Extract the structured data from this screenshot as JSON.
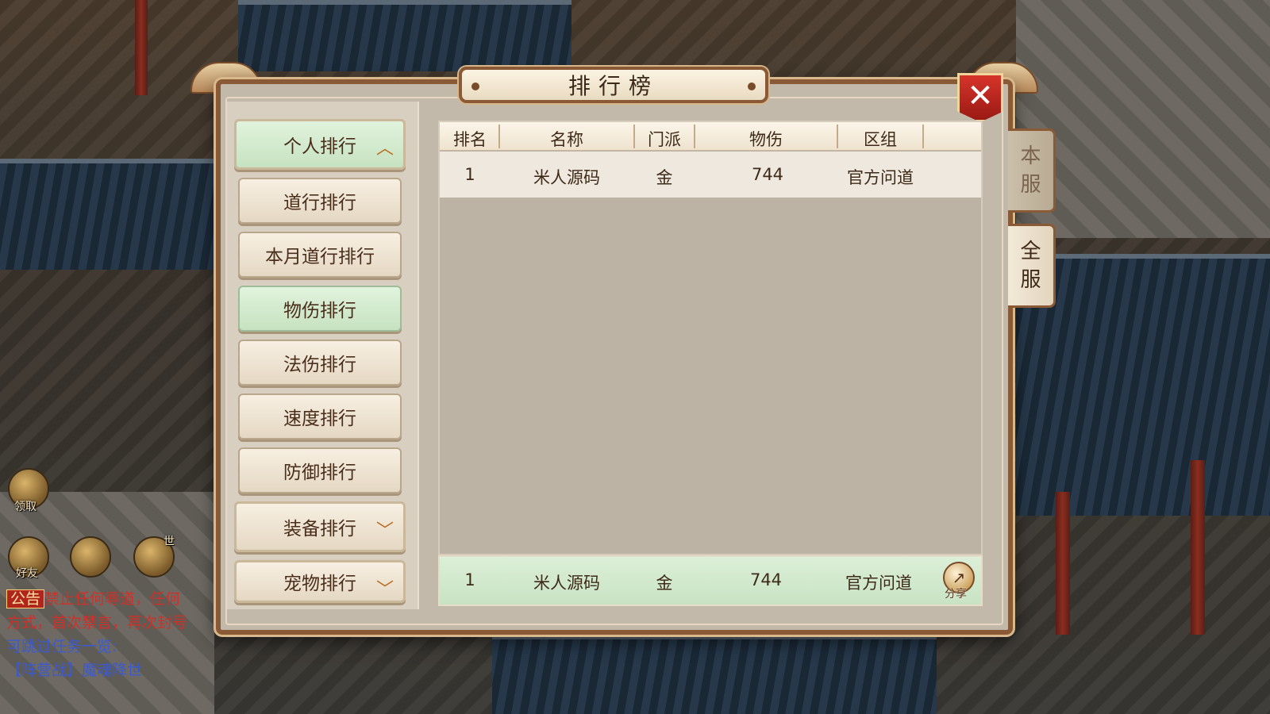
{
  "title": "排行榜",
  "close_icon": "close-icon",
  "menu": {
    "categories": [
      {
        "label": "个人排行",
        "expanded": true
      },
      {
        "label": "装备排行",
        "expanded": false
      },
      {
        "label": "宠物排行",
        "expanded": false
      }
    ],
    "items": [
      "道行排行",
      "本月道行排行",
      "物伤排行",
      "法伤排行",
      "速度排行",
      "防御排行"
    ],
    "selected": "物伤排行"
  },
  "table": {
    "columns": [
      "排名",
      "名称",
      "门派",
      "物伤",
      "区组"
    ],
    "rows": [
      {
        "rank": "1",
        "name": "米人源码",
        "school": "金",
        "value": "744",
        "group": "官方问道"
      }
    ],
    "my_row": {
      "rank": "1",
      "name": "米人源码",
      "school": "金",
      "value": "744",
      "group": "官方问道"
    },
    "share_label": "分享"
  },
  "server_tabs": {
    "local": [
      "本",
      "服"
    ],
    "all": [
      "全",
      "服"
    ],
    "selected": "all"
  },
  "hud": {
    "claim_label": "领取",
    "friends_label": "好友",
    "world_badge": "世",
    "chat": {
      "tag": "公告",
      "line1": "禁止任何辱道，任何",
      "line2": "方式，首次禁言，再次封号",
      "line3": "可跳过任务一览:",
      "line4": "【阵营战】魔魂降世"
    }
  },
  "colors": {
    "panel_border": "#8a5a36",
    "active_green": "#c6e2c0",
    "close_red": "#c82a20"
  }
}
